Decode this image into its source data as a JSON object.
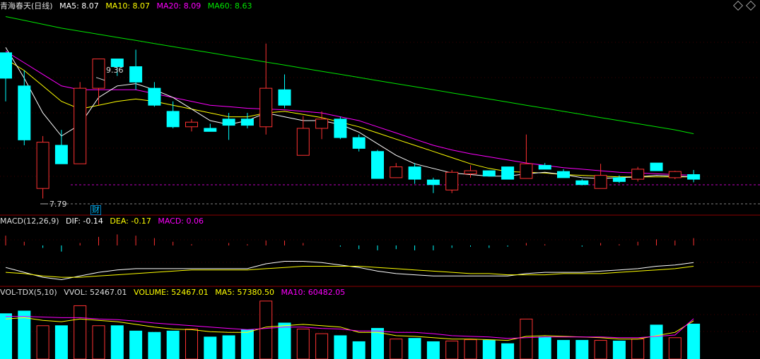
{
  "header": {
    "title": "青海春天(日线)",
    "ma5_label": "MA5: 8.07",
    "ma10_label": "MA10: 8.07",
    "ma20_label": "MA20: 8.09",
    "ma60_label": "MA60: 8.63"
  },
  "annotations": {
    "high_label": "9.36",
    "low_label": "7.79",
    "badge": "财"
  },
  "macd": {
    "title": "MACD(12,26,9)",
    "dif": "DIF: -0.14",
    "dea": "DEA: -0.17",
    "macd": "MACD: 0.06"
  },
  "volume": {
    "title": "VOL-TDX(5,10)",
    "vvol": "VVOL: 52467.01",
    "volume": "VOLUME: 52467.01",
    "ma5": "MA5: 57380.50",
    "ma10": "MA10: 60482.05"
  },
  "colors": {
    "up": "#ff3232",
    "down": "#00ffff",
    "ma5": "#ffffff",
    "ma10": "#ffff00",
    "ma20": "#ff00ff",
    "ma60": "#00e600",
    "grid": "#7a0000"
  },
  "chart_data": {
    "type": "candlestick",
    "price_range": [
      7.62,
      10.2
    ],
    "candles": [
      {
        "o": 9.68,
        "h": 9.68,
        "l": 9.05,
        "c": 9.35
      },
      {
        "o": 9.25,
        "h": 9.45,
        "l": 8.48,
        "c": 8.55
      },
      {
        "o": 7.92,
        "h": 8.6,
        "l": 7.79,
        "c": 8.52
      },
      {
        "o": 8.48,
        "h": 8.68,
        "l": 8.24,
        "c": 8.24
      },
      {
        "o": 8.24,
        "h": 9.3,
        "l": 8.24,
        "c": 9.22
      },
      {
        "o": 9.22,
        "h": 9.36,
        "l": 9.0,
        "c": 9.6
      },
      {
        "o": 9.6,
        "h": 9.6,
        "l": 9.38,
        "c": 9.5
      },
      {
        "o": 9.5,
        "h": 9.72,
        "l": 9.2,
        "c": 9.3
      },
      {
        "o": 9.22,
        "h": 9.3,
        "l": 8.98,
        "c": 9.0
      },
      {
        "o": 8.92,
        "h": 9.05,
        "l": 8.7,
        "c": 8.72
      },
      {
        "o": 8.72,
        "h": 8.82,
        "l": 8.66,
        "c": 8.78
      },
      {
        "o": 8.7,
        "h": 8.76,
        "l": 8.66,
        "c": 8.66
      },
      {
        "o": 8.82,
        "h": 8.9,
        "l": 8.55,
        "c": 8.74
      },
      {
        "o": 8.82,
        "h": 8.9,
        "l": 8.7,
        "c": 8.74
      },
      {
        "o": 8.72,
        "h": 9.8,
        "l": 8.62,
        "c": 9.22
      },
      {
        "o": 9.2,
        "h": 9.4,
        "l": 8.96,
        "c": 9.0
      },
      {
        "o": 8.35,
        "h": 8.86,
        "l": 8.35,
        "c": 8.7
      },
      {
        "o": 8.7,
        "h": 8.92,
        "l": 8.56,
        "c": 8.82
      },
      {
        "o": 8.82,
        "h": 8.85,
        "l": 8.56,
        "c": 8.58
      },
      {
        "o": 8.58,
        "h": 8.62,
        "l": 8.4,
        "c": 8.44
      },
      {
        "o": 8.4,
        "h": 8.42,
        "l": 8.05,
        "c": 8.05
      },
      {
        "o": 8.06,
        "h": 8.25,
        "l": 8.06,
        "c": 8.2
      },
      {
        "o": 8.2,
        "h": 8.25,
        "l": 7.98,
        "c": 8.04
      },
      {
        "o": 8.03,
        "h": 8.06,
        "l": 7.86,
        "c": 7.97
      },
      {
        "o": 7.9,
        "h": 8.16,
        "l": 7.86,
        "c": 8.13
      },
      {
        "o": 8.11,
        "h": 8.22,
        "l": 8.06,
        "c": 8.15
      },
      {
        "o": 8.15,
        "h": 8.15,
        "l": 8.08,
        "c": 8.08
      },
      {
        "o": 8.2,
        "h": 8.2,
        "l": 8.04,
        "c": 8.04
      },
      {
        "o": 8.05,
        "h": 8.62,
        "l": 8.05,
        "c": 8.24
      },
      {
        "o": 8.22,
        "h": 8.25,
        "l": 8.17,
        "c": 8.17
      },
      {
        "o": 8.14,
        "h": 8.17,
        "l": 8.06,
        "c": 8.06
      },
      {
        "o": 8.02,
        "h": 8.04,
        "l": 7.96,
        "c": 7.97
      },
      {
        "o": 7.92,
        "h": 8.24,
        "l": 7.92,
        "c": 8.09
      },
      {
        "o": 8.06,
        "h": 8.09,
        "l": 7.99,
        "c": 8.01
      },
      {
        "o": 8.04,
        "h": 8.2,
        "l": 8.01,
        "c": 8.17
      },
      {
        "o": 8.25,
        "h": 8.25,
        "l": 8.15,
        "c": 8.15
      },
      {
        "o": 8.06,
        "h": 8.15,
        "l": 8.04,
        "c": 8.14
      },
      {
        "o": 8.1,
        "h": 8.16,
        "l": 8.0,
        "c": 8.04
      }
    ],
    "ma_lines": {
      "ma5": [
        9.75,
        9.35,
        8.9,
        8.6,
        8.75,
        9.1,
        9.25,
        9.28,
        9.2,
        9.1,
        8.95,
        8.8,
        8.75,
        8.8,
        8.9,
        8.85,
        8.8,
        8.8,
        8.75,
        8.65,
        8.5,
        8.35,
        8.24,
        8.18,
        8.12,
        8.1,
        8.08,
        8.08,
        8.11,
        8.13,
        8.1,
        8.06,
        8.05,
        8.06,
        8.07,
        8.09,
        8.08,
        8.07
      ],
      "ma10": [
        9.6,
        9.45,
        9.25,
        9.05,
        8.95,
        9.0,
        9.05,
        9.08,
        9.05,
        9.0,
        8.95,
        8.9,
        8.85,
        8.85,
        8.9,
        8.92,
        8.88,
        8.84,
        8.78,
        8.72,
        8.64,
        8.56,
        8.48,
        8.4,
        8.32,
        8.24,
        8.18,
        8.14,
        8.13,
        8.12,
        8.1,
        8.09,
        8.08,
        8.07,
        8.07,
        8.07,
        8.07,
        8.07
      ],
      "ma20": [
        9.7,
        9.55,
        9.4,
        9.25,
        9.2,
        9.2,
        9.2,
        9.2,
        9.15,
        9.1,
        9.05,
        9.0,
        8.98,
        8.96,
        8.95,
        8.94,
        8.92,
        8.9,
        8.85,
        8.8,
        8.72,
        8.64,
        8.56,
        8.48,
        8.42,
        8.37,
        8.33,
        8.29,
        8.25,
        8.22,
        8.19,
        8.17,
        8.15,
        8.13,
        8.12,
        8.11,
        8.1,
        8.09
      ],
      "ma60": [
        10.15,
        10.1,
        10.05,
        10.0,
        9.96,
        9.92,
        9.88,
        9.84,
        9.8,
        9.76,
        9.72,
        9.68,
        9.64,
        9.6,
        9.56,
        9.52,
        9.48,
        9.44,
        9.4,
        9.36,
        9.32,
        9.28,
        9.24,
        9.2,
        9.16,
        9.12,
        9.08,
        9.04,
        9.0,
        8.96,
        8.92,
        8.88,
        8.84,
        8.8,
        8.76,
        8.72,
        8.68,
        8.63
      ]
    },
    "macd_range": [
      -0.3,
      0.15
    ],
    "macd_hist": [
      0.08,
      0.03,
      -0.02,
      -0.05,
      0.02,
      0.07,
      0.09,
      0.08,
      0.06,
      0.03,
      0.01,
      0.0,
      0.02,
      0.01,
      0.04,
      0.04,
      0.02,
      0.0,
      -0.01,
      -0.03,
      -0.04,
      -0.03,
      -0.04,
      -0.04,
      -0.02,
      -0.01,
      -0.02,
      -0.01,
      0.02,
      0.01,
      0.0,
      -0.01,
      0.02,
      0.01,
      0.03,
      0.05,
      0.04,
      0.06
    ],
    "dif": [
      -0.18,
      -0.22,
      -0.26,
      -0.28,
      -0.25,
      -0.22,
      -0.2,
      -0.19,
      -0.19,
      -0.19,
      -0.19,
      -0.19,
      -0.19,
      -0.19,
      -0.15,
      -0.13,
      -0.13,
      -0.14,
      -0.16,
      -0.18,
      -0.21,
      -0.23,
      -0.24,
      -0.25,
      -0.25,
      -0.25,
      -0.25,
      -0.25,
      -0.23,
      -0.22,
      -0.22,
      -0.22,
      -0.21,
      -0.2,
      -0.19,
      -0.17,
      -0.16,
      -0.14
    ],
    "dea": [
      -0.22,
      -0.23,
      -0.25,
      -0.26,
      -0.26,
      -0.25,
      -0.24,
      -0.23,
      -0.22,
      -0.21,
      -0.2,
      -0.2,
      -0.2,
      -0.2,
      -0.19,
      -0.18,
      -0.17,
      -0.17,
      -0.17,
      -0.17,
      -0.18,
      -0.19,
      -0.2,
      -0.21,
      -0.22,
      -0.23,
      -0.23,
      -0.24,
      -0.24,
      -0.24,
      -0.23,
      -0.23,
      -0.23,
      -0.22,
      -0.21,
      -0.2,
      -0.19,
      -0.17
    ],
    "vol_range": [
      0,
      90000
    ],
    "volumes": [
      68000,
      72000,
      50000,
      50000,
      80000,
      50000,
      50000,
      42000,
      40000,
      42000,
      45000,
      33000,
      35000,
      44000,
      87000,
      54000,
      45000,
      38000,
      35000,
      26000,
      46000,
      30000,
      31000,
      26000,
      27000,
      29000,
      28000,
      23000,
      60000,
      33000,
      28000,
      28000,
      28000,
      27000,
      30000,
      51000,
      32000,
      52467
    ],
    "vol_ma5": [
      60000,
      62000,
      58000,
      56000,
      60000,
      58000,
      56000,
      52000,
      48000,
      45000,
      44000,
      41000,
      40000,
      40000,
      48000,
      50000,
      52000,
      50000,
      48000,
      40000,
      40000,
      35000,
      34000,
      32000,
      30000,
      30000,
      29000,
      28000,
      34000,
      35000,
      34000,
      33000,
      32000,
      30000,
      30000,
      35000,
      40000,
      57380
    ],
    "vol_ma10": [
      64000,
      64000,
      63000,
      62000,
      62000,
      60000,
      59000,
      57000,
      54000,
      52000,
      50000,
      48000,
      46000,
      44000,
      46000,
      48000,
      48000,
      46000,
      45000,
      42000,
      42000,
      40000,
      40000,
      38000,
      35000,
      34000,
      33000,
      31000,
      32000,
      33000,
      33000,
      33000,
      33000,
      32000,
      32000,
      34000,
      36000,
      60482
    ]
  }
}
